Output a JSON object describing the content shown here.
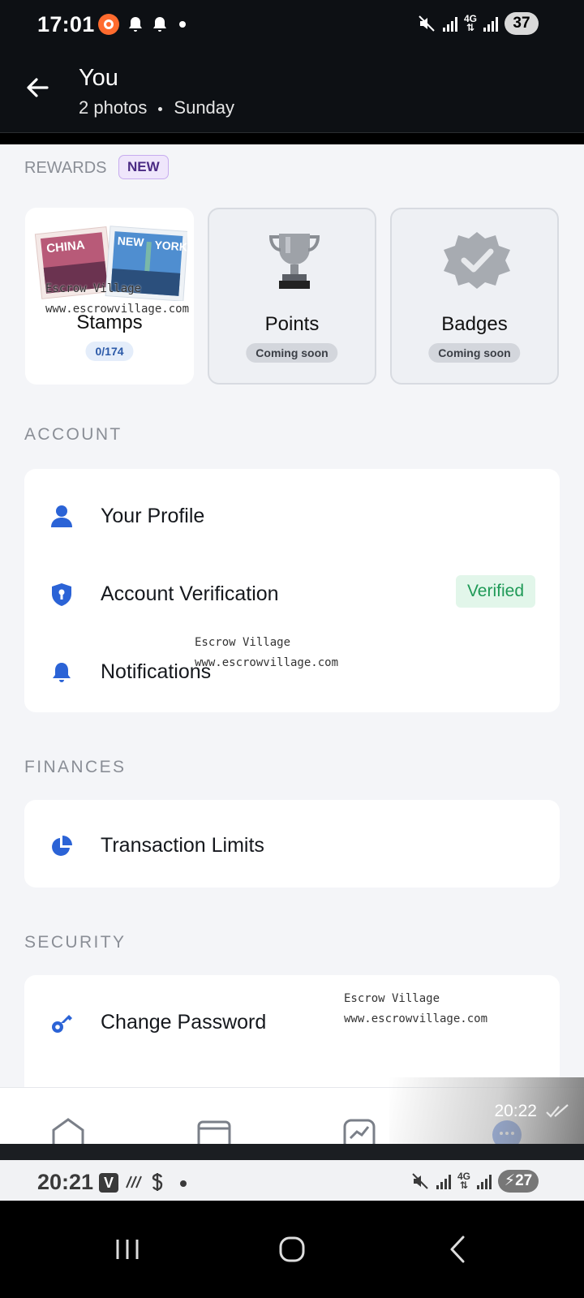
{
  "status_top": {
    "time": "17:01",
    "battery": "37",
    "network": "4G"
  },
  "viewer": {
    "title": "You",
    "photos": "2 photos",
    "day": "Sunday"
  },
  "rewards": {
    "label": "REWARDS",
    "new_badge": "NEW",
    "cards": [
      {
        "name": "Stamps",
        "pill": "0/174"
      },
      {
        "name": "Points",
        "pill": "Coming soon"
      },
      {
        "name": "Badges",
        "pill": "Coming soon"
      }
    ]
  },
  "account": {
    "label": "ACCOUNT",
    "items": [
      {
        "label": "Your Profile",
        "icon": "person-icon"
      },
      {
        "label": "Account Verification",
        "icon": "shield-icon",
        "badge": "Verified"
      },
      {
        "label": "Notifications",
        "icon": "bell-icon"
      }
    ]
  },
  "finances": {
    "label": "FINANCES",
    "items": [
      {
        "label": "Transaction Limits",
        "icon": "pie-chart-icon"
      }
    ]
  },
  "security": {
    "label": "SECURITY",
    "items": [
      {
        "label": "Change Password",
        "icon": "key-icon"
      }
    ]
  },
  "watermarks": {
    "name": "Escrow Village",
    "url": "www.escrowvillage.com"
  },
  "overlay": {
    "time": "20:22"
  },
  "status_bottom": {
    "time": "20:21",
    "battery": "27",
    "app_letter": "V",
    "network": "4G"
  },
  "colors": {
    "accent": "#2b63d6",
    "verified_text": "#1f9a57",
    "new_badge_bg": "#efe6fb"
  }
}
